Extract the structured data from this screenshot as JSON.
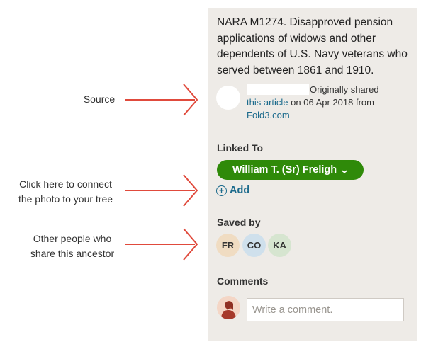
{
  "annotations": {
    "source": "Source",
    "connect": [
      "Click here to connect",
      "the photo to your tree"
    ],
    "others": [
      "Other people who",
      "share this ancestor"
    ]
  },
  "record": {
    "description": "NARA M1274. Disapproved pension applications of widows and other dependents of U.S. Navy veterans who served between 1861 and 1910.",
    "source": {
      "shared_text": "Originally shared",
      "article_link": "this article",
      "date_text": "on 06 Apr 2018 from",
      "site_link": "Fold3.com"
    }
  },
  "linked_to": {
    "title": "Linked To",
    "person": "William T. (Sr) Freligh",
    "add_label": "Add"
  },
  "saved_by": {
    "title": "Saved by",
    "users": [
      {
        "initials": "FR",
        "color": "#f0dcc2"
      },
      {
        "initials": "CO",
        "color": "#cfe0ec"
      },
      {
        "initials": "KA",
        "color": "#d6e5d0"
      }
    ]
  },
  "comments": {
    "title": "Comments",
    "placeholder": "Write a comment."
  },
  "colors": {
    "panel": "#eeebe7",
    "accent_green": "#2f8a09",
    "link_blue": "#1b6a8c",
    "arrow_red": "#e04a3c"
  }
}
